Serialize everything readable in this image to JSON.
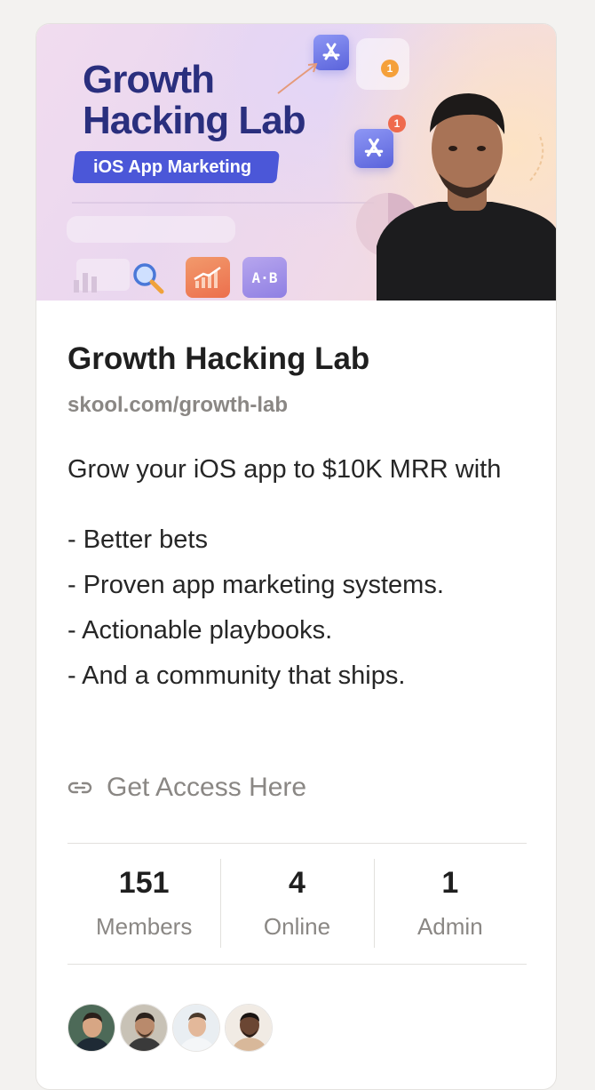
{
  "banner": {
    "title_line1": "Growth",
    "title_line2": "Hacking Lab",
    "subtitle": "iOS App Marketing",
    "badge_a": "1",
    "badge_b": "1",
    "ab_tile": "A·B",
    "colors": {
      "title": "#2a2f7e",
      "pill": "#4b57d8",
      "accent": "#f08a3c"
    }
  },
  "group": {
    "name": "Growth Hacking Lab",
    "url": "skool.com/growth-lab",
    "description_intro": "Grow your iOS app to $10K MRR with",
    "bullets": [
      "- Better bets",
      "- Proven app marketing systems.",
      "- Actionable playbooks.",
      "- And a community that ships."
    ],
    "link_icon": "link-icon",
    "link_label": "Get Access Here"
  },
  "stats": [
    {
      "value": "151",
      "label": "Members"
    },
    {
      "value": "4",
      "label": "Online"
    },
    {
      "value": "1",
      "label": "Admin"
    }
  ],
  "avatars": [
    "member-avatar-1",
    "member-avatar-2",
    "member-avatar-3",
    "member-avatar-4"
  ]
}
